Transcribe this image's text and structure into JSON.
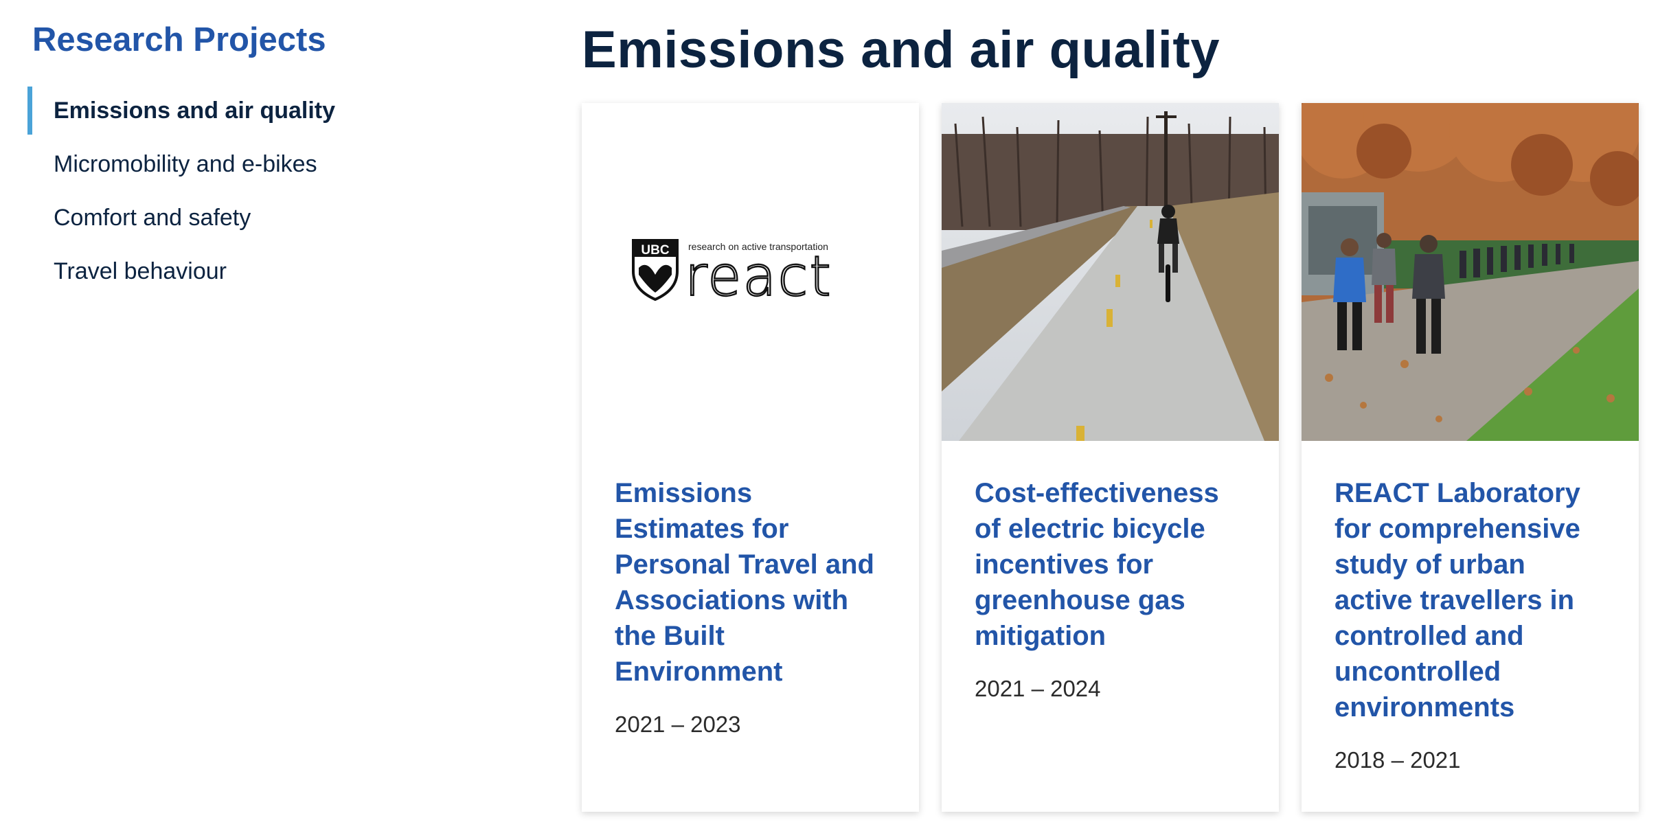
{
  "sidebar": {
    "title": "Research Projects",
    "items": [
      {
        "label": "Emissions and air quality",
        "active": true
      },
      {
        "label": "Micromobility and e-bikes",
        "active": false
      },
      {
        "label": "Comfort and safety",
        "active": false
      },
      {
        "label": "Travel behaviour",
        "active": false
      }
    ]
  },
  "main": {
    "title": "Emissions and air quality",
    "cards": [
      {
        "title": "Emissions Estimates for Personal Travel and Associations with the Built Environment",
        "dates": "2021 – 2023",
        "logo": {
          "crest_text": "UBC",
          "tagline": "research on active transportation",
          "wordmark": "react"
        }
      },
      {
        "title": "Cost-effectiveness of electric bicycle incentives for greenhouse gas mitigation",
        "dates": "2021 – 2024"
      },
      {
        "title": "REACT Laboratory for comprehensive study of urban active travellers in controlled and uncontrolled environments",
        "dates": "2018 – 2021"
      }
    ]
  },
  "colors": {
    "heading_blue": "#2255a8",
    "navy": "#0c2340",
    "active_indicator": "#4aa3d8"
  }
}
